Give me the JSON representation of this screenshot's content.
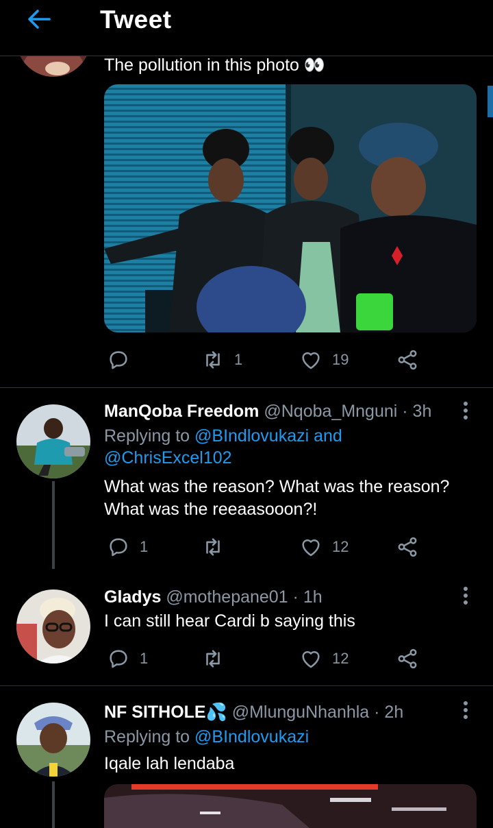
{
  "header": {
    "title": "Tweet"
  },
  "main_tweet": {
    "text": "The pollution in this photo 👀",
    "stats": {
      "replies": "",
      "retweets": "1",
      "likes": "19"
    }
  },
  "replies": [
    {
      "name": "ManQoba Freedom",
      "handle": "@Nqoba_Mnguni · 3h",
      "replying_label": "Replying to ",
      "mention1": "@BIndlovukazi and",
      "mention2": "@ChrisExcel102",
      "text_line1": "What was the reason? What was the reason?",
      "text_line2": "What was the reeaasooon?!",
      "stats": {
        "replies": "1",
        "retweets": "",
        "likes": "12"
      }
    },
    {
      "name": "Gladys",
      "handle": "@mothepane01 · 1h",
      "text_line1": "I can still hear Cardi b saying this",
      "stats": {
        "replies": "1",
        "retweets": "",
        "likes": "12"
      }
    },
    {
      "name": "NF SITHOLE💦",
      "handle": "@MlunguNhanhla · 2h",
      "replying_label": "Replying to ",
      "mention1": "@BIndlovukazi",
      "text_line1": "Iqale lah lendaba"
    }
  ],
  "colors": {
    "background": "#000000",
    "accent": "#1d9bf0",
    "muted": "#8b98a5",
    "divider": "#2f3336"
  },
  "icons": [
    "back-arrow-icon",
    "reply-icon",
    "retweet-icon",
    "like-icon",
    "share-icon",
    "more-icon"
  ]
}
